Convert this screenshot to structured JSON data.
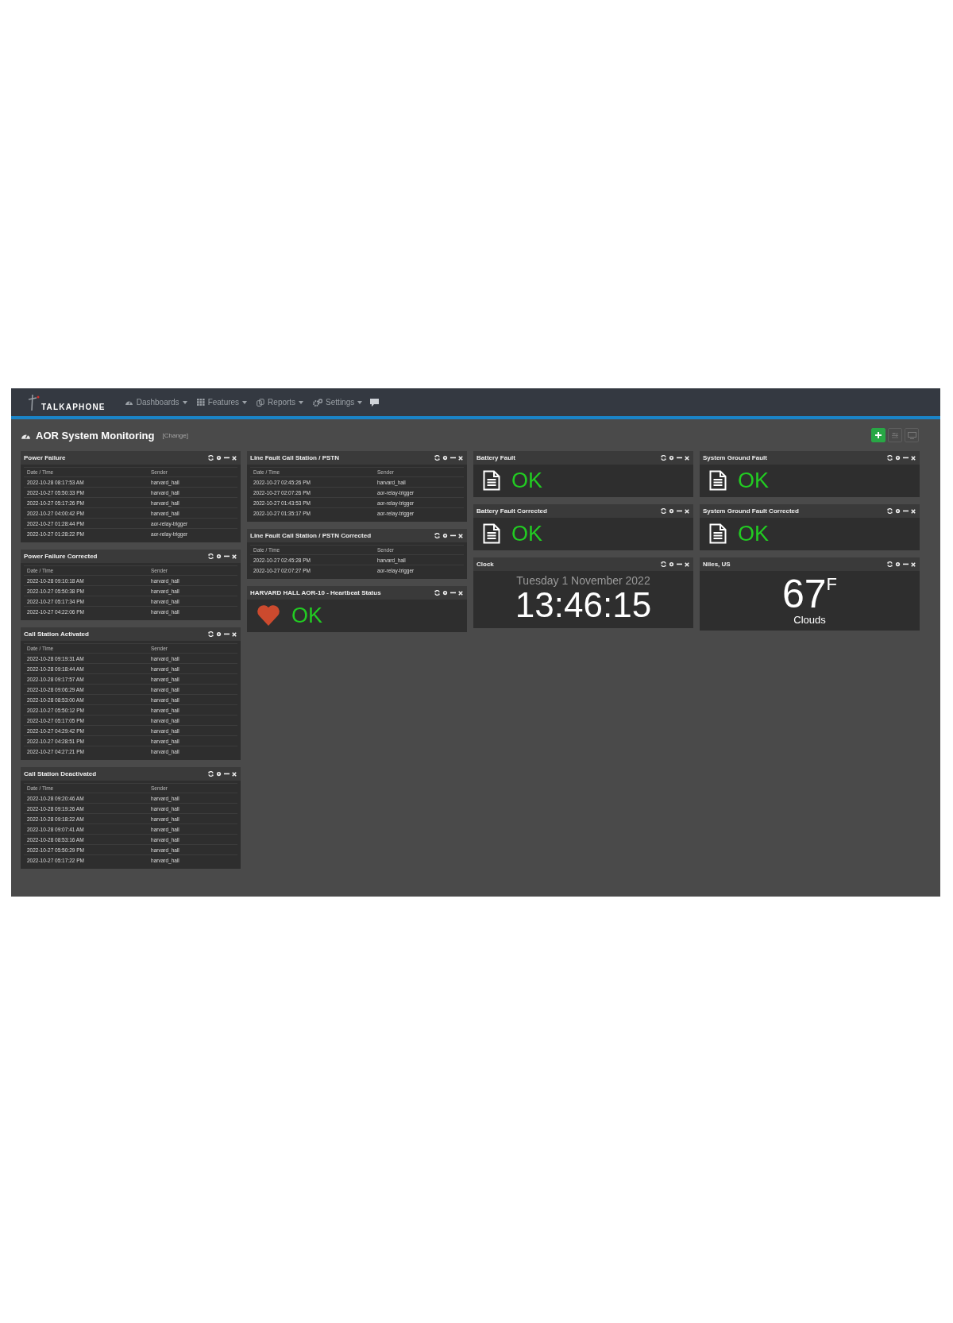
{
  "navbar": {
    "brand": "TALKAPHONE",
    "menu": [
      {
        "label": "Dashboards"
      },
      {
        "label": "Features"
      },
      {
        "label": "Reports"
      },
      {
        "label": "Settings"
      }
    ]
  },
  "dashboard": {
    "title": "AOR System Monitoring",
    "change_link": "[Change]"
  },
  "columns": [
    [
      {
        "kind": "table",
        "title": "Power Failure",
        "columns": [
          "Date / Time",
          "Sender"
        ],
        "rows": [
          [
            "2022-10-28 08:17:53 AM",
            "harvard_hall"
          ],
          [
            "2022-10-27 05:50:33 PM",
            "harvard_hall"
          ],
          [
            "2022-10-27 05:17:26 PM",
            "harvard_hall"
          ],
          [
            "2022-10-27 04:00:42 PM",
            "harvard_hall"
          ],
          [
            "2022-10-27 01:28:44 PM",
            "aor-relay-trigger"
          ],
          [
            "2022-10-27 01:28:22 PM",
            "aor-relay-trigger"
          ]
        ]
      },
      {
        "kind": "table",
        "title": "Power Failure Corrected",
        "columns": [
          "Date / Time",
          "Sender"
        ],
        "rows": [
          [
            "2022-10-28 09:10:18 AM",
            "harvard_hall"
          ],
          [
            "2022-10-27 05:50:38 PM",
            "harvard_hall"
          ],
          [
            "2022-10-27 05:17:34 PM",
            "harvard_hall"
          ],
          [
            "2022-10-27 04:22:06 PM",
            "harvard_hall"
          ]
        ]
      },
      {
        "kind": "table",
        "title": "Call Station Activated",
        "columns": [
          "Date / Time",
          "Sender"
        ],
        "rows": [
          [
            "2022-10-28 09:19:31 AM",
            "harvard_hall"
          ],
          [
            "2022-10-28 09:18:44 AM",
            "harvard_hall"
          ],
          [
            "2022-10-28 09:17:57 AM",
            "harvard_hall"
          ],
          [
            "2022-10-28 09:06:29 AM",
            "harvard_hall"
          ],
          [
            "2022-10-28 08:53:00 AM",
            "harvard_hall"
          ],
          [
            "2022-10-27 05:50:12 PM",
            "harvard_hall"
          ],
          [
            "2022-10-27 05:17:05 PM",
            "harvard_hall"
          ],
          [
            "2022-10-27 04:29:42 PM",
            "harvard_hall"
          ],
          [
            "2022-10-27 04:28:51 PM",
            "harvard_hall"
          ],
          [
            "2022-10-27 04:27:21 PM",
            "harvard_hall"
          ]
        ]
      },
      {
        "kind": "table",
        "title": "Call Station Deactivated",
        "columns": [
          "Date / Time",
          "Sender"
        ],
        "rows": [
          [
            "2022-10-28 09:20:46 AM",
            "harvard_hall"
          ],
          [
            "2022-10-28 09:19:26 AM",
            "harvard_hall"
          ],
          [
            "2022-10-28 09:18:22 AM",
            "harvard_hall"
          ],
          [
            "2022-10-28 09:07:41 AM",
            "harvard_hall"
          ],
          [
            "2022-10-28 08:53:16 AM",
            "harvard_hall"
          ],
          [
            "2022-10-27 05:50:29 PM",
            "harvard_hall"
          ],
          [
            "2022-10-27 05:17:22 PM",
            "harvard_hall"
          ]
        ]
      }
    ],
    [
      {
        "kind": "table",
        "title": "Line Fault Call Station / PSTN",
        "columns": [
          "Date / Time",
          "Sender"
        ],
        "rows": [
          [
            "2022-10-27 02:45:26 PM",
            "harvard_hall"
          ],
          [
            "2022-10-27 02:07:26 PM",
            "aor-relay-trigger"
          ],
          [
            "2022-10-27 01:43:53 PM",
            "aor-relay-trigger"
          ],
          [
            "2022-10-27 01:35:17 PM",
            "aor-relay-trigger"
          ]
        ]
      },
      {
        "kind": "table",
        "title": "Line Fault Call Station / PSTN Corrected",
        "columns": [
          "Date / Time",
          "Sender"
        ],
        "rows": [
          [
            "2022-10-27 02:45:28 PM",
            "harvard_hall"
          ],
          [
            "2022-10-27 02:07:27 PM",
            "aor-relay-trigger"
          ]
        ]
      },
      {
        "kind": "heartbeat",
        "title": "HARVARD HALL AOR-10 - Heartbeat Status",
        "status": "OK"
      }
    ],
    [
      {
        "kind": "status",
        "title": "Battery Fault",
        "status": "OK"
      },
      {
        "kind": "status",
        "title": "Battery Fault Corrected",
        "status": "OK"
      },
      {
        "kind": "clock",
        "title": "Clock",
        "date": "Tuesday 1 November 2022",
        "time": "13:46:15"
      }
    ],
    [
      {
        "kind": "status",
        "title": "System Ground Fault",
        "status": "OK"
      },
      {
        "kind": "status",
        "title": "System Ground Fault Corrected",
        "status": "OK"
      },
      {
        "kind": "weather",
        "title": "Niles, US",
        "temperature": "67",
        "unit": "F",
        "condition": "Clouds"
      }
    ]
  ]
}
